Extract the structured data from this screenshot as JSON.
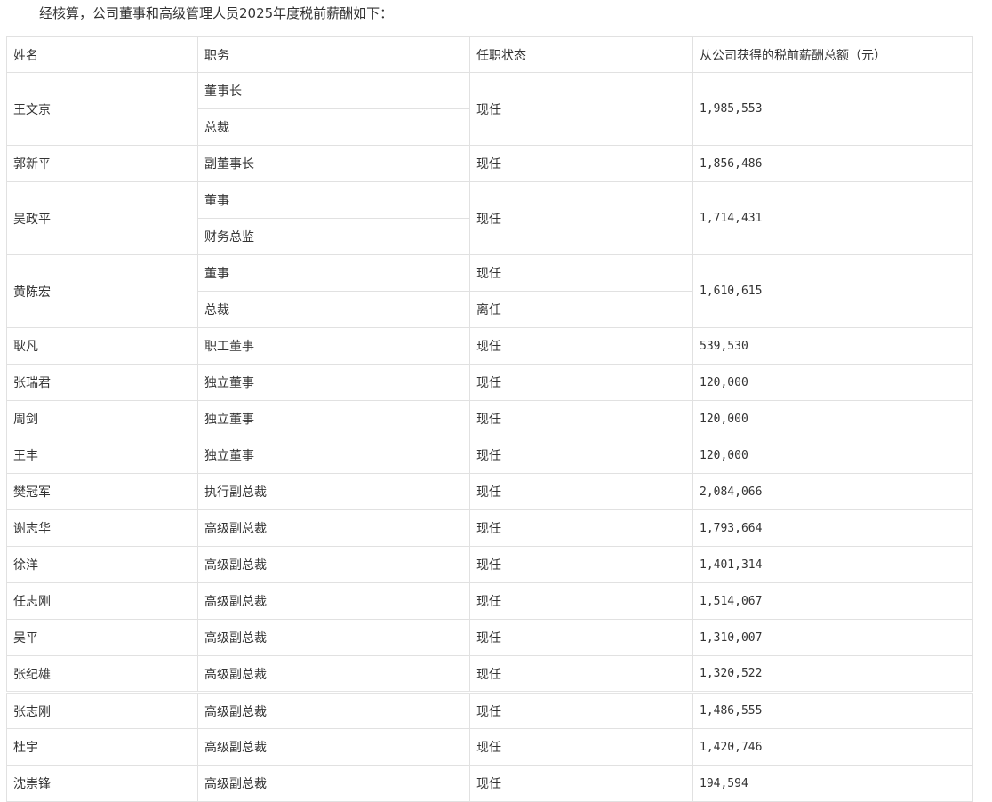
{
  "intro": "经核算，公司董事和高级管理人员2025年度税前薪酬如下：",
  "headers": {
    "name": "姓名",
    "title": "职务",
    "status": "任职状态",
    "pay": "从公司获得的税前薪酬总额（元）"
  },
  "rows": [
    {
      "name": "王文京",
      "title1": "董事长",
      "title2": "总裁",
      "status": "现任",
      "pay": "1,985,553"
    },
    {
      "name": "郭新平",
      "title": "副董事长",
      "status": "现任",
      "pay": "1,856,486"
    },
    {
      "name": "吴政平",
      "title1": "董事",
      "title2": "财务总监",
      "status": "现任",
      "pay": "1,714,431"
    },
    {
      "name": "黄陈宏",
      "title1": "董事",
      "title2": "总裁",
      "status1": "现任",
      "status2": "离任",
      "pay": "1,610,615"
    },
    {
      "name": "耿凡",
      "title": "职工董事",
      "status": "现任",
      "pay": "539,530"
    },
    {
      "name": "张瑞君",
      "title": "独立董事",
      "status": "现任",
      "pay": "120,000"
    },
    {
      "name": "周剑",
      "title": "独立董事",
      "status": "现任",
      "pay": "120,000"
    },
    {
      "name": "王丰",
      "title": "独立董事",
      "status": "现任",
      "pay": "120,000"
    },
    {
      "name": "樊冠军",
      "title": "执行副总裁",
      "status": "现任",
      "pay": "2,084,066"
    },
    {
      "name": "谢志华",
      "title": "高级副总裁",
      "status": "现任",
      "pay": "1,793,664"
    },
    {
      "name": "徐洋",
      "title": "高级副总裁",
      "status": "现任",
      "pay": "1,401,314"
    },
    {
      "name": "任志刚",
      "title": "高级副总裁",
      "status": "现任",
      "pay": "1,514,067"
    },
    {
      "name": "吴平",
      "title": "高级副总裁",
      "status": "现任",
      "pay": "1,310,007"
    },
    {
      "name": "张纪雄",
      "title": "高级副总裁",
      "status": "现任",
      "pay": "1,320,522"
    },
    {
      "name": "张志刚",
      "title": "高级副总裁",
      "status": "现任",
      "pay": "1,486,555"
    },
    {
      "name": "杜宇",
      "title": "高级副总裁",
      "status": "现任",
      "pay": "1,420,746"
    },
    {
      "name": "沈崇锋",
      "title": "高级副总裁",
      "status": "现任",
      "pay": "194,594"
    }
  ]
}
